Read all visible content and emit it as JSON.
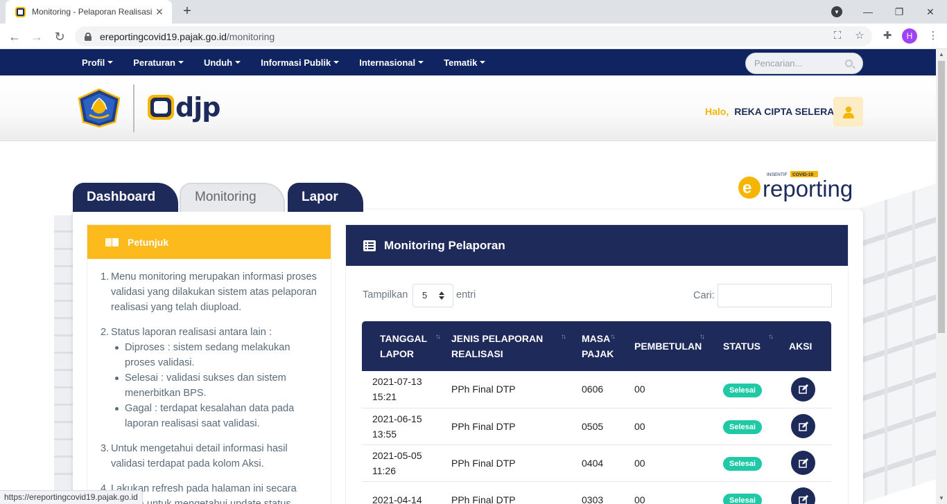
{
  "browser": {
    "tab_title": "Monitoring - Pelaporan Realisasi",
    "url_host": "ereportingcovid19.pajak.go.id",
    "url_path": "/monitoring",
    "profile_initial": "H",
    "status_url": "https://ereportingcovid19.pajak.go.id"
  },
  "topnav": {
    "menu": [
      "Profil",
      "Peraturan",
      "Unduh",
      "Informasi Publik",
      "Internasional",
      "Tematik"
    ],
    "search_placeholder": "Pencarian..."
  },
  "header": {
    "logo_text": "djp",
    "greeting": "Halo,",
    "user_name": "REKA CIPTA SELERA"
  },
  "brand": {
    "ereporting_small": "INSENTIF",
    "ereporting_badge": "COVID-19",
    "ereporting_text": "reporting"
  },
  "tabs": [
    "Dashboard",
    "Monitoring",
    "Lapor"
  ],
  "petunjuk": {
    "title": "Petunjuk",
    "items": [
      {
        "num": "1.",
        "text": "Menu monitoring merupakan informasi proses validasi yang dilakukan sistem atas pelaporan realisasi yang telah diupload."
      },
      {
        "num": "2.",
        "text": "Status laporan realisasi antara lain :",
        "sub": [
          "Diproses : sistem sedang melakukan proses validasi.",
          "Selesai : validasi sukses dan sistem menerbitkan BPS.",
          "Gagal : terdapat kesalahan data pada laporan realisasi saat validasi."
        ]
      },
      {
        "num": "3.",
        "text": "Untuk mengetahui detail informasi hasil validasi terdapat pada kolom Aksi."
      },
      {
        "num": "4.",
        "text": "Lakukan refresh pada halaman ini secara berkala untuk mengetahui update status."
      }
    ]
  },
  "monitoring": {
    "title": "Monitoring Pelaporan",
    "show_label": "Tampilkan",
    "page_length": "5",
    "entries_label": "entri",
    "search_label": "Cari:",
    "columns": [
      "TANGGAL LAPOR",
      "JENIS PELAPORAN REALISASI",
      "MASA PAJAK",
      "PEMBETULAN",
      "STATUS",
      "AKSI"
    ],
    "rows": [
      {
        "date": "2021-07-13",
        "time": "15:21",
        "jenis": "PPh Final DTP",
        "masa": "0606",
        "pembetulan": "00",
        "status": "Selesai"
      },
      {
        "date": "2021-06-15",
        "time": "13:55",
        "jenis": "PPh Final DTP",
        "masa": "0505",
        "pembetulan": "00",
        "status": "Selesai"
      },
      {
        "date": "2021-05-05",
        "time": "11:26",
        "jenis": "PPh Final DTP",
        "masa": "0404",
        "pembetulan": "00",
        "status": "Selesai"
      },
      {
        "date": "2021-04-14",
        "time": "",
        "jenis": "PPh Final DTP",
        "masa": "0303",
        "pembetulan": "00",
        "status": "Selesai"
      }
    ]
  },
  "colors": {
    "navy": "#1e2a5a",
    "topnav": "#0f2460",
    "accent_yellow": "#fdba1d",
    "status_green": "#20c9a6"
  }
}
